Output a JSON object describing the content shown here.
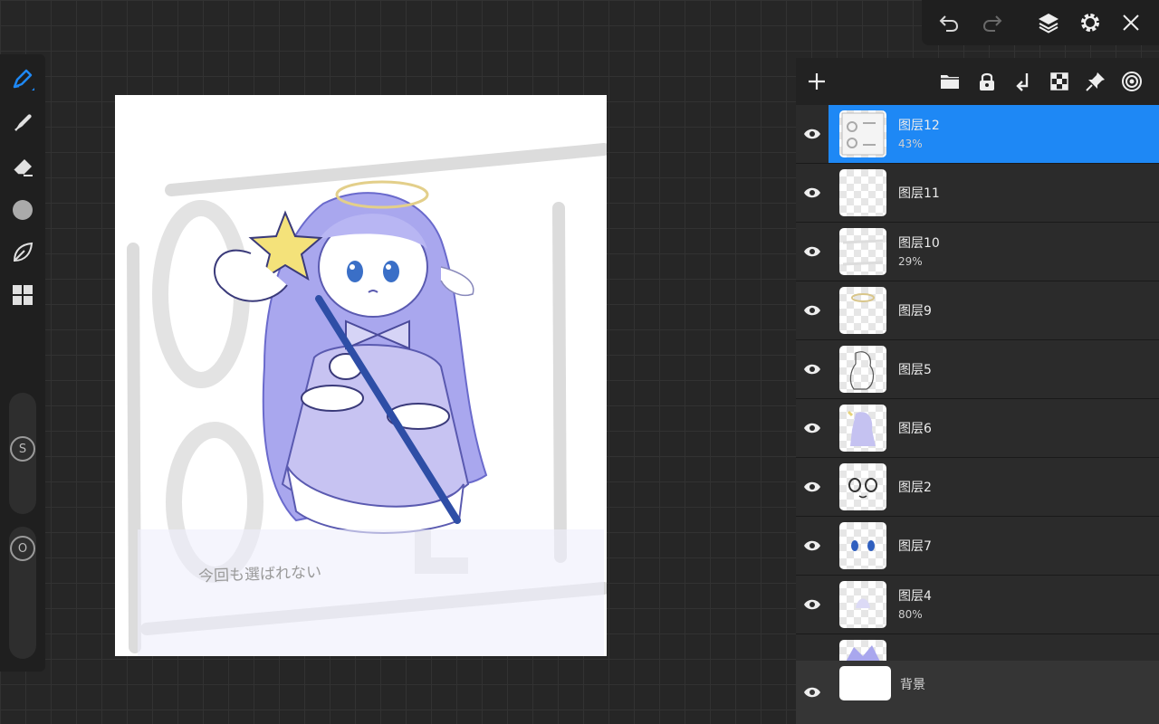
{
  "toolbar": {
    "tools": [
      {
        "name": "pen-tool",
        "icon": "pen-icon",
        "active": true
      },
      {
        "name": "smudge-tool",
        "icon": "smudge-icon"
      },
      {
        "name": "eraser-tool",
        "icon": "eraser-icon"
      },
      {
        "name": "color-tool",
        "icon": "color-circle-icon"
      },
      {
        "name": "brush-library",
        "icon": "leaf-icon"
      },
      {
        "name": "more-tools",
        "icon": "grid-icon"
      }
    ],
    "size_slider_label": "S",
    "opacity_slider_label": "O"
  },
  "topbar": {
    "buttons": [
      "undo-icon",
      "redo-icon",
      "layers-icon",
      "gear-icon",
      "close-icon"
    ]
  },
  "canvas": {
    "handwritten_text": "今回も選ばれない"
  },
  "layer_panel": {
    "toolbar": [
      "add-layer-icon",
      "folder-icon",
      "lock-icon",
      "merge-down-icon",
      "checker-icon",
      "pin-icon",
      "target-icon"
    ],
    "layers": [
      {
        "name": "图层12",
        "opacity": "43%",
        "selected": true
      },
      {
        "name": "图层11",
        "opacity": ""
      },
      {
        "name": "图层10",
        "opacity": "29%"
      },
      {
        "name": "图层9",
        "opacity": ""
      },
      {
        "name": "图层5",
        "opacity": ""
      },
      {
        "name": "图层6",
        "opacity": ""
      },
      {
        "name": "图层2",
        "opacity": ""
      },
      {
        "name": "图层7",
        "opacity": ""
      },
      {
        "name": "图层4",
        "opacity": "80%"
      }
    ],
    "background_layer": "背景"
  },
  "colors": {
    "accent": "#1e88f5",
    "panel": "#222222",
    "row": "#2b2b2b"
  }
}
